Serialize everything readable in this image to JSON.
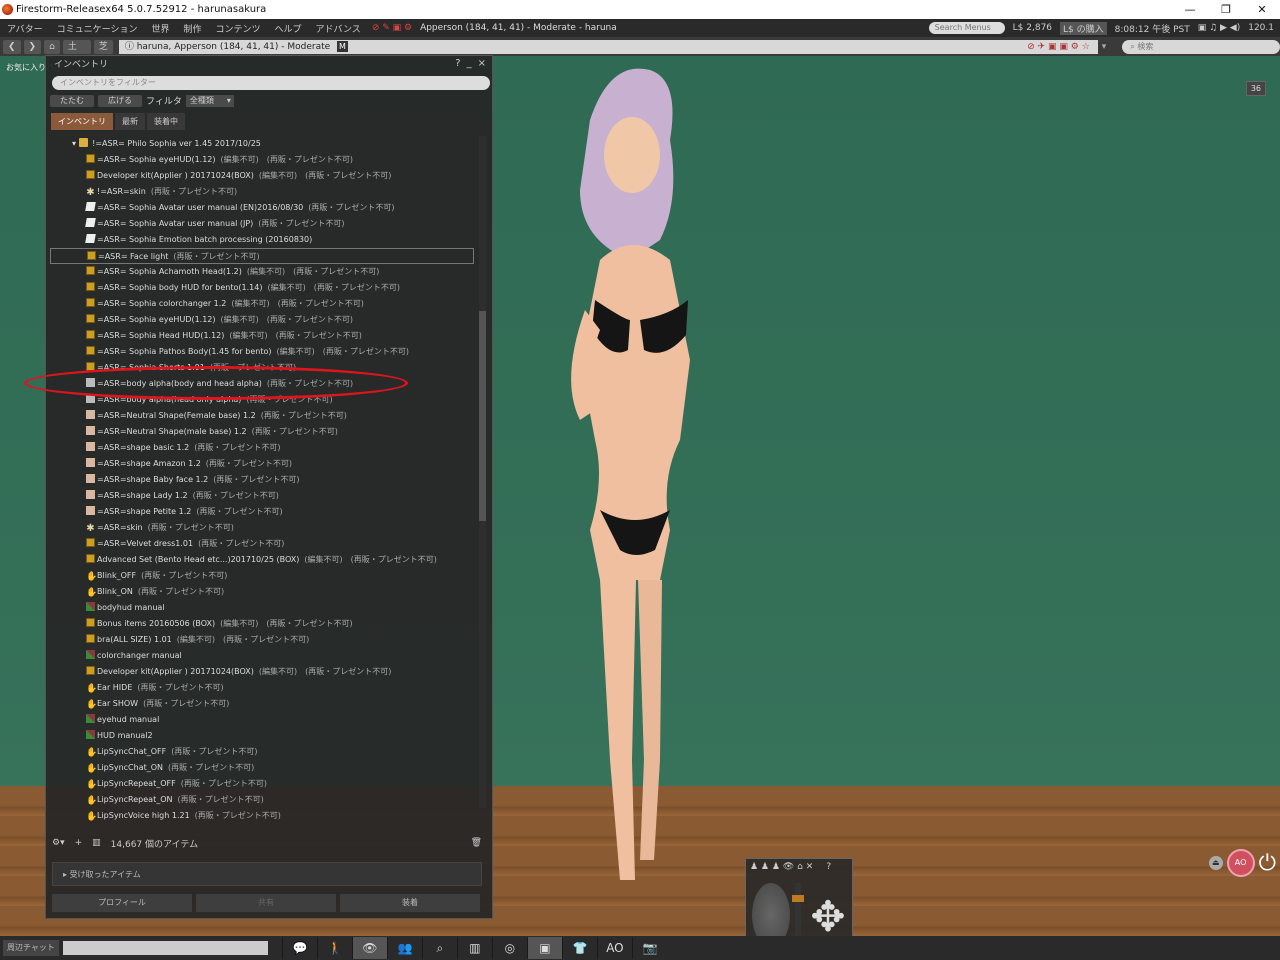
{
  "window": {
    "title": "Firestorm-Releasex64 5.0.7.52912 - harunasakura",
    "controls": [
      "—",
      "❐",
      "✕"
    ]
  },
  "menubar": {
    "items": [
      "アバター",
      "コミュニケーション",
      "世界",
      "制作",
      "コンテンツ",
      "ヘルプ",
      "アドバンス"
    ],
    "location": "Apperson (184, 41, 41) - Moderate - haruna",
    "search_placeholder": "Search Menus",
    "balance": "L$ 2,876",
    "buy": "L$ の購入",
    "time": "8:08:12 午後 PST",
    "fps": "120.1"
  },
  "navbar": {
    "home": "⌂",
    "btn1": "土地",
    "btn2": "芝",
    "url": "haruna, Apperson (184, 41, 41) - Moderate",
    "maturity": "M",
    "search_placeholder": "検索"
  },
  "scene": {
    "favorites": "お気に入りバ",
    "badge": "36"
  },
  "inventory": {
    "title": "インベントリ",
    "filter_placeholder": "インベントリをフィルター",
    "collapse": "たたむ",
    "expand": "広げる",
    "filter_label": "フィルタ",
    "filter_value": "全種類",
    "tabs": [
      "インベントリ",
      "最新",
      "装着中"
    ],
    "folder": "!=ASR= Philo Sophia ver 1.45 2017/10/25",
    "items": [
      {
        "icon": "box",
        "name": "=ASR= Sophia eyeHUD(1.12)",
        "perm": "(編集不可)　(再販・プレゼント不可)"
      },
      {
        "icon": "box",
        "name": "Developer kit(Applier ) 20171024(BOX)",
        "perm": "(編集不可)　(再販・プレゼント不可)"
      },
      {
        "icon": "skin",
        "name": "!=ASR=skin",
        "perm": "(再販・プレゼント不可)"
      },
      {
        "icon": "note",
        "name": "=ASR=  Sophia Avatar user manual (EN)2016/08/30",
        "perm": "(再販・プレゼント不可)"
      },
      {
        "icon": "note",
        "name": "=ASR=  Sophia Avatar user manual (JP)",
        "perm": "(再販・プレゼント不可)"
      },
      {
        "icon": "note",
        "name": "=ASR=  Sophia Emotion batch processing (20160830)",
        "perm": ""
      },
      {
        "icon": "box",
        "name": "=ASR= Face light",
        "perm": "(再販・プレゼント不可)",
        "selected": true
      },
      {
        "icon": "box",
        "name": "=ASR= Sophia Achamoth Head(1.2)",
        "perm": "(編集不可)　(再販・プレゼント不可)"
      },
      {
        "icon": "box",
        "name": "=ASR= Sophia body HUD for bento(1.14)",
        "perm": "(編集不可)　(再販・プレゼント不可)"
      },
      {
        "icon": "box",
        "name": "=ASR= Sophia colorchanger 1.2",
        "perm": "(編集不可)　(再販・プレゼント不可)"
      },
      {
        "icon": "box",
        "name": "=ASR= Sophia eyeHUD(1.12)",
        "perm": "(編集不可)　(再販・プレゼント不可)"
      },
      {
        "icon": "box",
        "name": "=ASR= Sophia Head HUD(1.12)",
        "perm": "(編集不可)　(再販・プレゼント不可)"
      },
      {
        "icon": "box",
        "name": "=ASR= Sophia Pathos Body(1.45 for bento)",
        "perm": "(編集不可)　(再販・プレゼント不可)"
      },
      {
        "icon": "box",
        "name": "=ASR= Sophia Shorts 1.01",
        "perm": "(再販・プレゼント不可)"
      },
      {
        "icon": "shirt",
        "name": "=ASR=body alpha(body and head alpha)",
        "perm": "(再販・プレゼント不可)"
      },
      {
        "icon": "shirt",
        "name": "=ASR=body alpha(head only alpha)",
        "perm": "(再販・プレゼント不可)"
      },
      {
        "icon": "shape",
        "name": "=ASR=Neutral Shape(Female base) 1.2",
        "perm": "(再販・プレゼント不可)"
      },
      {
        "icon": "shape",
        "name": "=ASR=Neutral Shape(male base) 1.2",
        "perm": "(再販・プレゼント不可)"
      },
      {
        "icon": "shape",
        "name": "=ASR=shape  basic 1.2",
        "perm": "(再販・プレゼント不可)"
      },
      {
        "icon": "shape",
        "name": "=ASR=shape Amazon 1.2",
        "perm": "(再販・プレゼント不可)"
      },
      {
        "icon": "shape",
        "name": "=ASR=shape Baby face 1.2",
        "perm": "(再販・プレゼント不可)"
      },
      {
        "icon": "shape",
        "name": "=ASR=shape Lady 1.2",
        "perm": "(再販・プレゼント不可)"
      },
      {
        "icon": "shape",
        "name": "=ASR=shape Petite 1.2",
        "perm": "(再販・プレゼント不可)"
      },
      {
        "icon": "skin",
        "name": "=ASR=skin",
        "perm": "(再販・プレゼント不可)"
      },
      {
        "icon": "box",
        "name": "=ASR=Velvet dress1.01",
        "perm": "(再販・プレゼント不可)"
      },
      {
        "icon": "box",
        "name": "Advanced Set (Bento Head etc...)201710/25 (BOX)",
        "perm": "(編集不可)　(再販・プレゼント不可)"
      },
      {
        "icon": "gesture",
        "name": "Blink_OFF",
        "perm": "(再販・プレゼント不可)"
      },
      {
        "icon": "gesture",
        "name": "Blink_ON",
        "perm": "(再販・プレゼント不可)"
      },
      {
        "icon": "tex",
        "name": "bodyhud manual",
        "perm": ""
      },
      {
        "icon": "box",
        "name": "Bonus items 20160506 (BOX)",
        "perm": "(編集不可)　(再販・プレゼント不可)"
      },
      {
        "icon": "box",
        "name": "bra(ALL SIZE) 1.01",
        "perm": "(編集不可)　(再販・プレゼント不可)"
      },
      {
        "icon": "tex",
        "name": "colorchanger  manual",
        "perm": ""
      },
      {
        "icon": "box",
        "name": "Developer kit(Applier ) 20171024(BOX)",
        "perm": "(編集不可)　(再販・プレゼント不可)"
      },
      {
        "icon": "gesture",
        "name": "Ear HIDE",
        "perm": "(再販・プレゼント不可)"
      },
      {
        "icon": "gesture",
        "name": "Ear SHOW",
        "perm": "(再販・プレゼント不可)"
      },
      {
        "icon": "tex",
        "name": "eyehud manual",
        "perm": ""
      },
      {
        "icon": "tex",
        "name": "HUD manual2",
        "perm": ""
      },
      {
        "icon": "gesture",
        "name": "LipSyncChat_OFF",
        "perm": "(再販・プレゼント不可)"
      },
      {
        "icon": "gesture",
        "name": "LipSyncChat_ON",
        "perm": "(再販・プレゼント不可)"
      },
      {
        "icon": "gesture",
        "name": "LipSyncRepeat_OFF",
        "perm": "(再販・プレゼント不可)"
      },
      {
        "icon": "gesture",
        "name": "LipSyncRepeat_ON",
        "perm": "(再販・プレゼント不可)"
      },
      {
        "icon": "gesture",
        "name": "LipSyncVoice high 1.21",
        "perm": "(再販・プレゼント不可)"
      }
    ],
    "item_count": "14,667 個のアイテム",
    "received": "受け取ったアイテム",
    "profile_btn": "プロフィール",
    "share_btn": "共有",
    "wear_btn": "装着"
  },
  "bottombar": {
    "chat_label": "周辺チャット",
    "ao": "AO",
    "ao_label": "AO"
  },
  "colors": {
    "accent": "#8a5a3a",
    "highlight_oval": "#e0141c",
    "scene_bg": "#346f58"
  }
}
